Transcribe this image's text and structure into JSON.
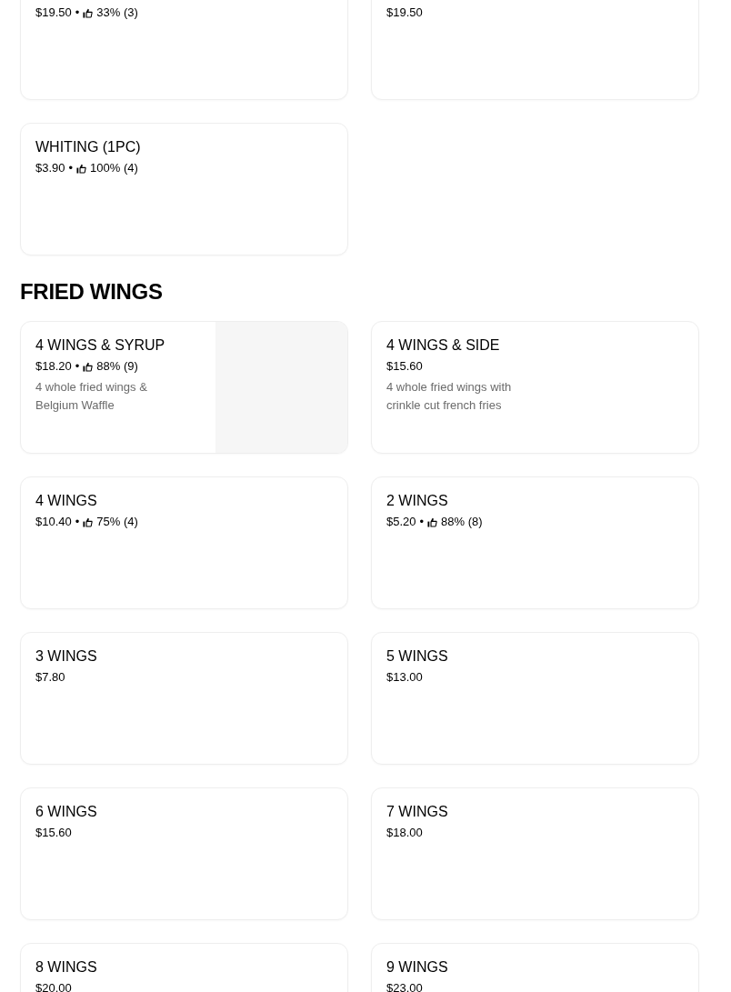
{
  "sections": [
    {
      "items": [
        {
          "price": "$19.50",
          "separator": "•",
          "rating": "33% (3)"
        },
        {
          "price": "$19.50"
        },
        {
          "name": "WHITING (1PC)",
          "price": "$3.90",
          "separator": "•",
          "rating": "100% (4)"
        }
      ]
    },
    {
      "title": "FRIED WINGS",
      "items": [
        {
          "name": "4 WINGS & SYRUP",
          "price": "$18.20",
          "separator": "•",
          "rating": "88% (9)",
          "description": "4 whole fried wings & Belgium Waffle",
          "image": true
        },
        {
          "name": "4 WINGS & SIDE",
          "price": "$15.60",
          "description": "4 whole fried wings with crinkle cut french fries"
        },
        {
          "name": "4 WINGS",
          "price": "$10.40",
          "separator": "•",
          "rating": "75% (4)"
        },
        {
          "name": "2 WINGS",
          "price": "$5.20",
          "separator": "•",
          "rating": "88% (8)"
        },
        {
          "name": "3 WINGS",
          "price": "$7.80"
        },
        {
          "name": "5 WINGS",
          "price": "$13.00"
        },
        {
          "name": "6 WINGS",
          "price": "$15.60"
        },
        {
          "name": "7 WINGS",
          "price": "$18.00"
        },
        {
          "name": "8 WINGS",
          "price": "$20.00"
        },
        {
          "name": "9 WINGS",
          "price": "$23.00"
        }
      ]
    }
  ]
}
